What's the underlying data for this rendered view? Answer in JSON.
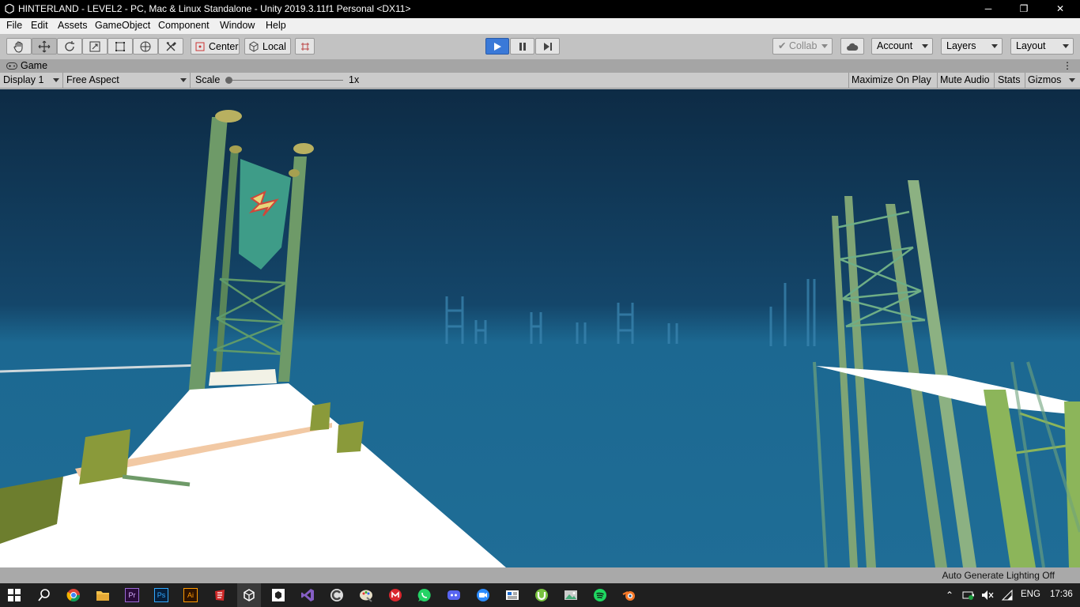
{
  "window": {
    "title": "HINTERLAND - LEVEL2 - PC, Mac & Linux Standalone - Unity 2019.3.11f1 Personal <DX11>",
    "minimize_glyph": "─",
    "restore_glyph": "❐",
    "close_glyph": "✕"
  },
  "menu": {
    "items": [
      "File",
      "Edit",
      "Assets",
      "GameObject",
      "Component",
      "Window",
      "Help"
    ]
  },
  "toolbar": {
    "tools": [
      "hand-tool-icon",
      "move-tool-icon",
      "rotate-tool-icon",
      "scale-tool-icon",
      "rect-tool-icon",
      "transform-tool-icon",
      "custom-tool-icon"
    ],
    "pivot_label": "Center",
    "space_label": "Local",
    "collab_label": "Collab",
    "account_label": "Account",
    "layers_label": "Layers",
    "layout_label": "Layout"
  },
  "game_view": {
    "tab_label": "Game",
    "display_label": "Display 1",
    "aspect_label": "Free Aspect",
    "scale_label": "Scale",
    "scale_value": "1x",
    "maximize_label": "Maximize On Play",
    "mute_label": "Mute Audio",
    "stats_label": "Stats",
    "gizmos_label": "Gizmos"
  },
  "status": {
    "lighting": "Auto Generate Lighting Off"
  },
  "taskbar": {
    "apps": [
      "start-icon",
      "search-icon",
      "chrome-icon",
      "file-explorer-icon",
      "premiere-icon",
      "photoshop-icon",
      "illustrator-icon",
      "red-app-icon",
      "unity-icon",
      "unity-hub-icon",
      "visual-studio-icon",
      "ccleaner-icon",
      "paint-icon",
      "mega-icon",
      "whatsapp-icon",
      "discord-icon",
      "zoom-icon",
      "news-icon",
      "utorrent-icon",
      "photos-icon",
      "spotify-icon",
      "blender-icon"
    ],
    "premiere_text": "Pr",
    "photoshop_text": "Ps",
    "illustrator_text": "Ai",
    "language": "ENG",
    "time": "17:36"
  },
  "colors": {
    "sky_top": "#0d2b45",
    "sea": "#1e6b93",
    "pillar_green": "#7fa475",
    "banner_teal": "#3e9c88",
    "platform_white": "#ffffff",
    "play_blue": "#3a79d8"
  }
}
